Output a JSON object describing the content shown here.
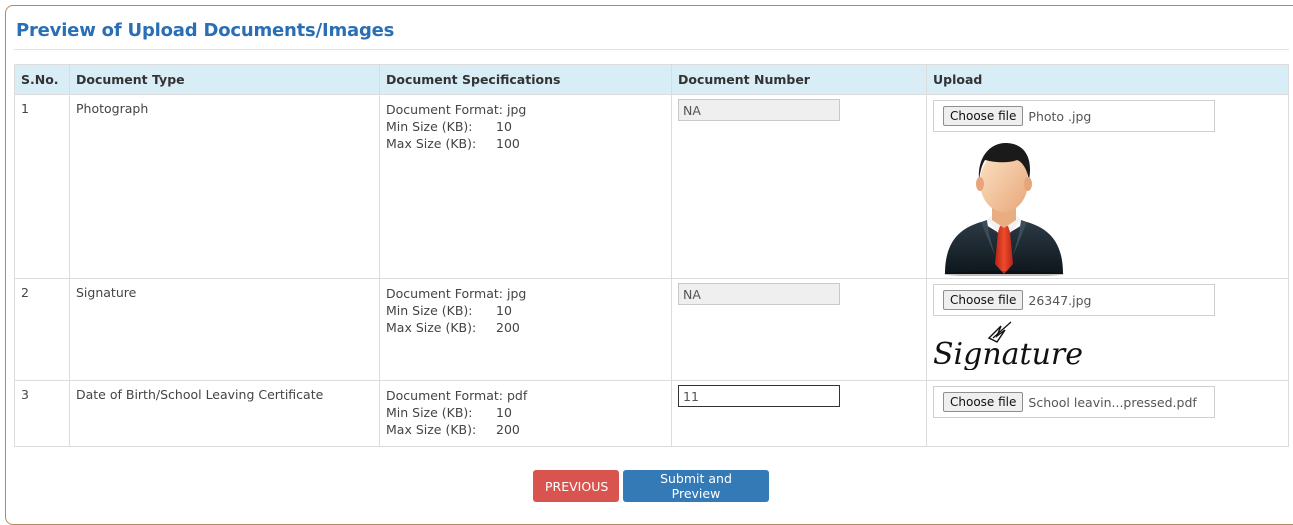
{
  "page": {
    "title": "Preview of Upload Documents/Images"
  },
  "table": {
    "headers": [
      "S.No.",
      "Document Type",
      "Document Specifications",
      "Document Number",
      "Upload"
    ],
    "spec_labels": {
      "format": "Document Format:",
      "min": "Min Size (KB):",
      "max": "Max Size (KB):"
    },
    "rows": [
      {
        "sno": "1",
        "type": "Photograph",
        "format": "jpg",
        "min": "10",
        "max": "100",
        "doc_number": "NA",
        "choose_label": "Choose file",
        "file_name": "Photo .jpg",
        "preview": "person-avatar-icon"
      },
      {
        "sno": "2",
        "type": "Signature",
        "format": "jpg",
        "min": "10",
        "max": "200",
        "doc_number": "NA",
        "choose_label": "Choose file",
        "file_name": "26347.jpg",
        "preview": "signature-image"
      },
      {
        "sno": "3",
        "type": "Date of Birth/School Leaving Certificate",
        "format": "pdf",
        "min": "10",
        "max": "200",
        "doc_number": "11",
        "choose_label": "Choose file",
        "file_name": "School leavin...pressed.pdf",
        "preview": ""
      }
    ]
  },
  "signature": {
    "text": "Signature"
  },
  "actions": {
    "previous_label": "PREVIOUS",
    "submit_label": "Submit and Preview"
  },
  "colors": {
    "title": "#2a6fb5",
    "header_bg": "#d9edf7",
    "previous": "#d9534f",
    "submit": "#337ab7"
  }
}
